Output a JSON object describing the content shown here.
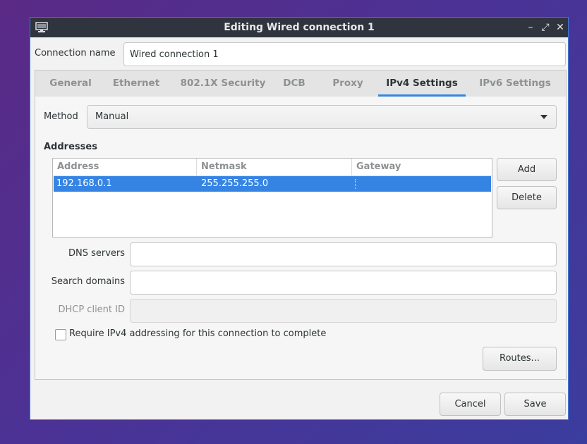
{
  "window": {
    "title": "Editing Wired connection 1",
    "icon": "network-app-icon",
    "controls": {
      "minimize": "–",
      "maximize": "⤢",
      "close": "✕"
    }
  },
  "connection": {
    "label": "Connection name",
    "value": "Wired connection 1"
  },
  "tabs": [
    {
      "label": "General"
    },
    {
      "label": "Ethernet"
    },
    {
      "label": "802.1X Security"
    },
    {
      "label": "DCB"
    },
    {
      "label": "Proxy"
    },
    {
      "label": "IPv4 Settings",
      "active": true
    },
    {
      "label": "IPv6 Settings"
    }
  ],
  "ipv4": {
    "method_label": "Method",
    "method_value": "Manual",
    "addresses_heading": "Addresses",
    "columns": [
      "Address",
      "Netmask",
      "Gateway"
    ],
    "rows": [
      {
        "address": "192.168.0.1",
        "netmask": "255.255.255.0",
        "gateway": ""
      }
    ],
    "add_label": "Add",
    "delete_label": "Delete",
    "dns_label": "DNS servers",
    "dns_value": "",
    "search_label": "Search domains",
    "search_value": "",
    "dhcp_label": "DHCP client ID",
    "dhcp_value": "",
    "require_label": "Require IPv4 addressing for this connection to complete",
    "require_checked": false,
    "routes_label": "Routes..."
  },
  "footer": {
    "cancel_label": "Cancel",
    "save_label": "Save"
  },
  "colors": {
    "accent": "#3584e4",
    "titlebar": "#2f343f",
    "window_border": "#3d7bd8"
  }
}
